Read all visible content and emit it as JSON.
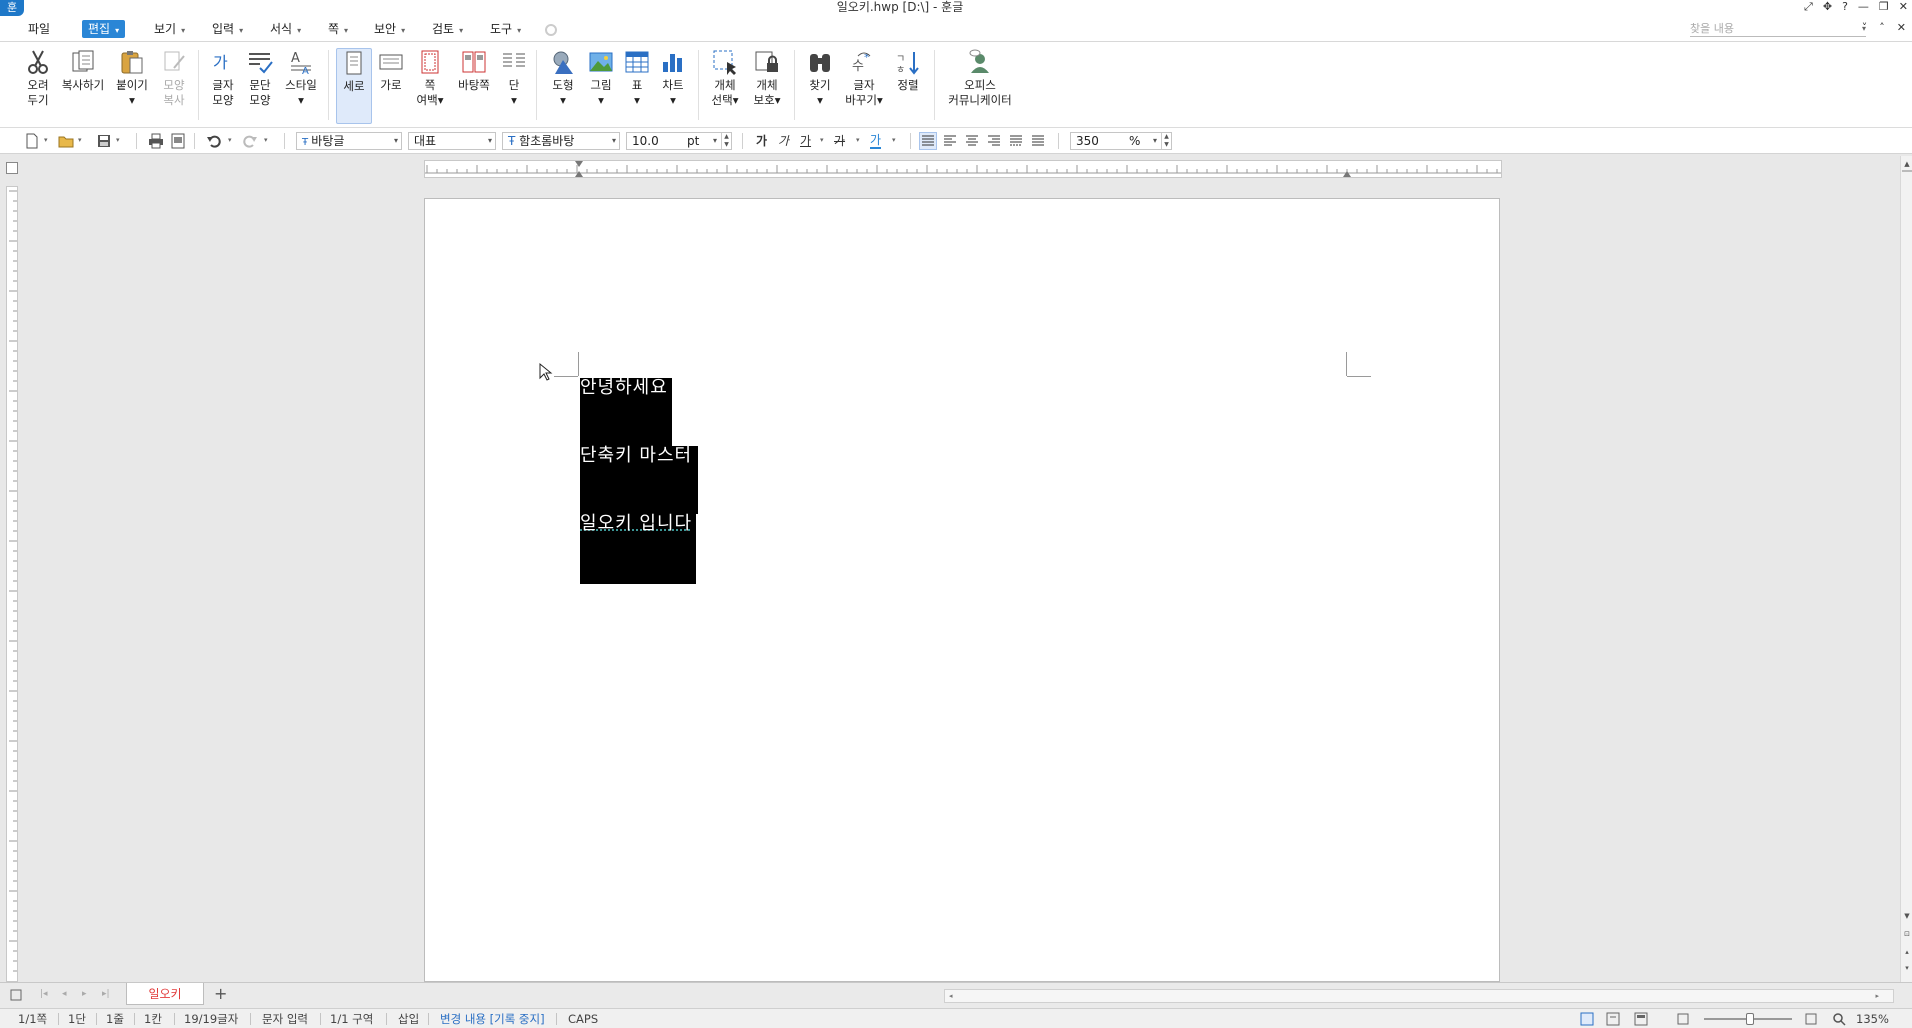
{
  "window": {
    "title": "일오키.hwp [D:\\] - 훈글",
    "logo": "훈",
    "controls": [
      "⤢",
      "✥",
      "?",
      "—",
      "❐",
      "✕"
    ],
    "sub_controls": [
      "˅",
      "˄",
      "✕"
    ]
  },
  "menubar": {
    "items": [
      {
        "label": "파일",
        "caret": false,
        "active": false
      },
      {
        "label": "편집",
        "caret": true,
        "active": true
      },
      {
        "label": "보기",
        "caret": true,
        "active": false
      },
      {
        "label": "입력",
        "caret": true,
        "active": false
      },
      {
        "label": "서식",
        "caret": true,
        "active": false
      },
      {
        "label": "쪽",
        "caret": true,
        "active": false
      },
      {
        "label": "보안",
        "caret": true,
        "active": false
      },
      {
        "label": "검토",
        "caret": true,
        "active": false
      },
      {
        "label": "도구",
        "caret": true,
        "active": false
      }
    ],
    "caret_glyph": "▾",
    "search_placeholder": "찾을 내용"
  },
  "ribbon": {
    "buttons": [
      {
        "id": "cut",
        "label": "오려\n두기",
        "icon": "scissors-icon"
      },
      {
        "id": "copy",
        "label": "복사하기",
        "icon": "copy-icon"
      },
      {
        "id": "paste",
        "label": "붙이기\n▾",
        "icon": "paste-icon"
      },
      {
        "id": "format-copy",
        "label": "모양\n복사",
        "icon": "format-painter-icon",
        "disabled": true
      },
      {
        "id": "char-shape",
        "label": "글자\n모양",
        "icon": "char-shape-icon"
      },
      {
        "id": "para-shape",
        "label": "문단\n모양",
        "icon": "para-shape-icon"
      },
      {
        "id": "style",
        "label": "스타일\n▾",
        "icon": "style-icon"
      },
      {
        "id": "portrait",
        "label": "세로",
        "icon": "portrait-page-icon",
        "selected": true
      },
      {
        "id": "landscape",
        "label": "가로",
        "icon": "landscape-page-icon"
      },
      {
        "id": "margins",
        "label": "쪽\n여백▾",
        "icon": "page-margins-icon"
      },
      {
        "id": "background",
        "label": "바탕쪽",
        "icon": "background-page-icon"
      },
      {
        "id": "columns",
        "label": "단\n▾",
        "icon": "columns-icon"
      },
      {
        "id": "shapes",
        "label": "도형\n▾",
        "icon": "shapes-icon"
      },
      {
        "id": "picture",
        "label": "그림\n▾",
        "icon": "picture-icon"
      },
      {
        "id": "table",
        "label": "표\n▾",
        "icon": "table-icon"
      },
      {
        "id": "chart",
        "label": "차트\n▾",
        "icon": "chart-icon"
      },
      {
        "id": "select-object",
        "label": "개체\n선택▾",
        "icon": "select-object-icon"
      },
      {
        "id": "protect-object",
        "label": "개체\n보호▾",
        "icon": "protect-object-icon"
      },
      {
        "id": "find",
        "label": "찾기\n▾",
        "icon": "binoculars-icon"
      },
      {
        "id": "replace-char",
        "label": "글자\n바꾸기▾",
        "icon": "replace-char-icon"
      },
      {
        "id": "sort",
        "label": "정렬",
        "icon": "sort-icon"
      },
      {
        "id": "office-communicator",
        "label": "오피스\n커뮤니케이터",
        "icon": "communicator-icon"
      }
    ]
  },
  "toolbar": {
    "style_value": "바탕글",
    "lang_value": "대표",
    "font_value": "함초롬바탕",
    "font_prefix": "Ŧ",
    "size_value": "10.0",
    "size_unit": "pt",
    "bold": "가",
    "italic": "가",
    "underline": "가",
    "strike": "가",
    "color": "가",
    "zoom_value": "350",
    "zoom_unit": "%"
  },
  "document": {
    "lines": [
      "안녕하세요",
      "단축키 마스터",
      "일오키 입니다"
    ]
  },
  "tabs": {
    "nav": [
      "|◂",
      "◂",
      "▸",
      "▸|"
    ],
    "active_tab": "일오키",
    "add": "+"
  },
  "status": {
    "page": "1/1쪽",
    "column": "1단",
    "line": "1줄",
    "cell": "1칸",
    "chars": "19/19글자",
    "mode": "문자 입력",
    "section": "1/1 구역",
    "insert": "삽입",
    "changes": "변경 내용 [기록 중지]",
    "caps": "CAPS",
    "zoom": "135%"
  },
  "colors": {
    "accent": "#2a86d6",
    "tab_text": "#e23c3c",
    "selection": "#000000"
  }
}
